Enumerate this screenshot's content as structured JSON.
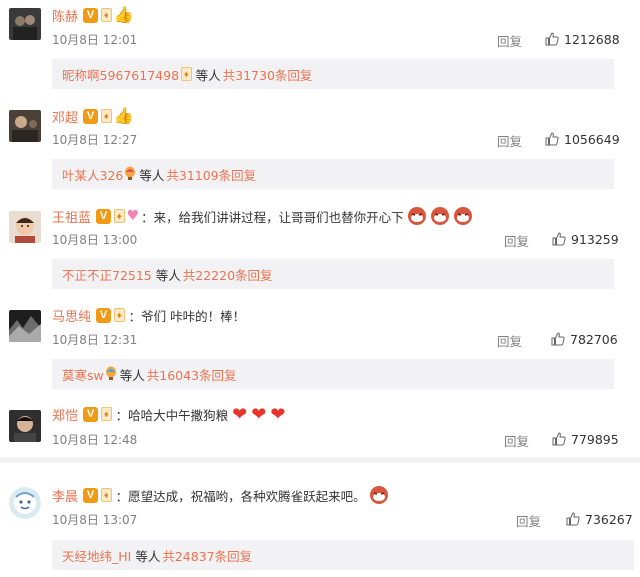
{
  "ui": {
    "reply_label": "回复",
    "and_others": "等人",
    "like_icon": "thumbs-up-icon",
    "verified_badge": "V"
  },
  "comments": [
    {
      "username": "陈赫",
      "text": "",
      "date": "10月8日 12:01",
      "likes": "1212688",
      "sub_user": "昵称啊5967617498",
      "sub_total": "共31730条回复"
    },
    {
      "username": "邓超",
      "text": "",
      "date": "10月8日 12:27",
      "likes": "1056649",
      "sub_user": "叶某人326",
      "sub_total": "共31109条回复"
    },
    {
      "username": "王祖蓝",
      "text": "：来，给我们讲讲过程，让哥哥们也替你开心下",
      "date": "10月8日 13:00",
      "likes": "913259",
      "sub_user": "不正不正72515",
      "sub_total": "共22220条回复"
    },
    {
      "username": "马思纯",
      "text": "：爷们 咔咔的！棒！",
      "date": "10月8日 12:31",
      "likes": "782706",
      "sub_user": "莫寒sw",
      "sub_total": "共16043条回复"
    },
    {
      "username": "郑恺",
      "text": "：哈哈大中午撒狗粮",
      "date": "10月8日 12:48",
      "likes": "779895",
      "sub_user": "",
      "sub_total": ""
    },
    {
      "username": "李晨",
      "text": "：愿望达成，祝福哟，各种欢腾雀跃起来吧。",
      "date": "10月8日 13:07",
      "likes": "736267",
      "sub_user": "天经地纬_HI",
      "sub_total": "共24837条回复"
    }
  ]
}
